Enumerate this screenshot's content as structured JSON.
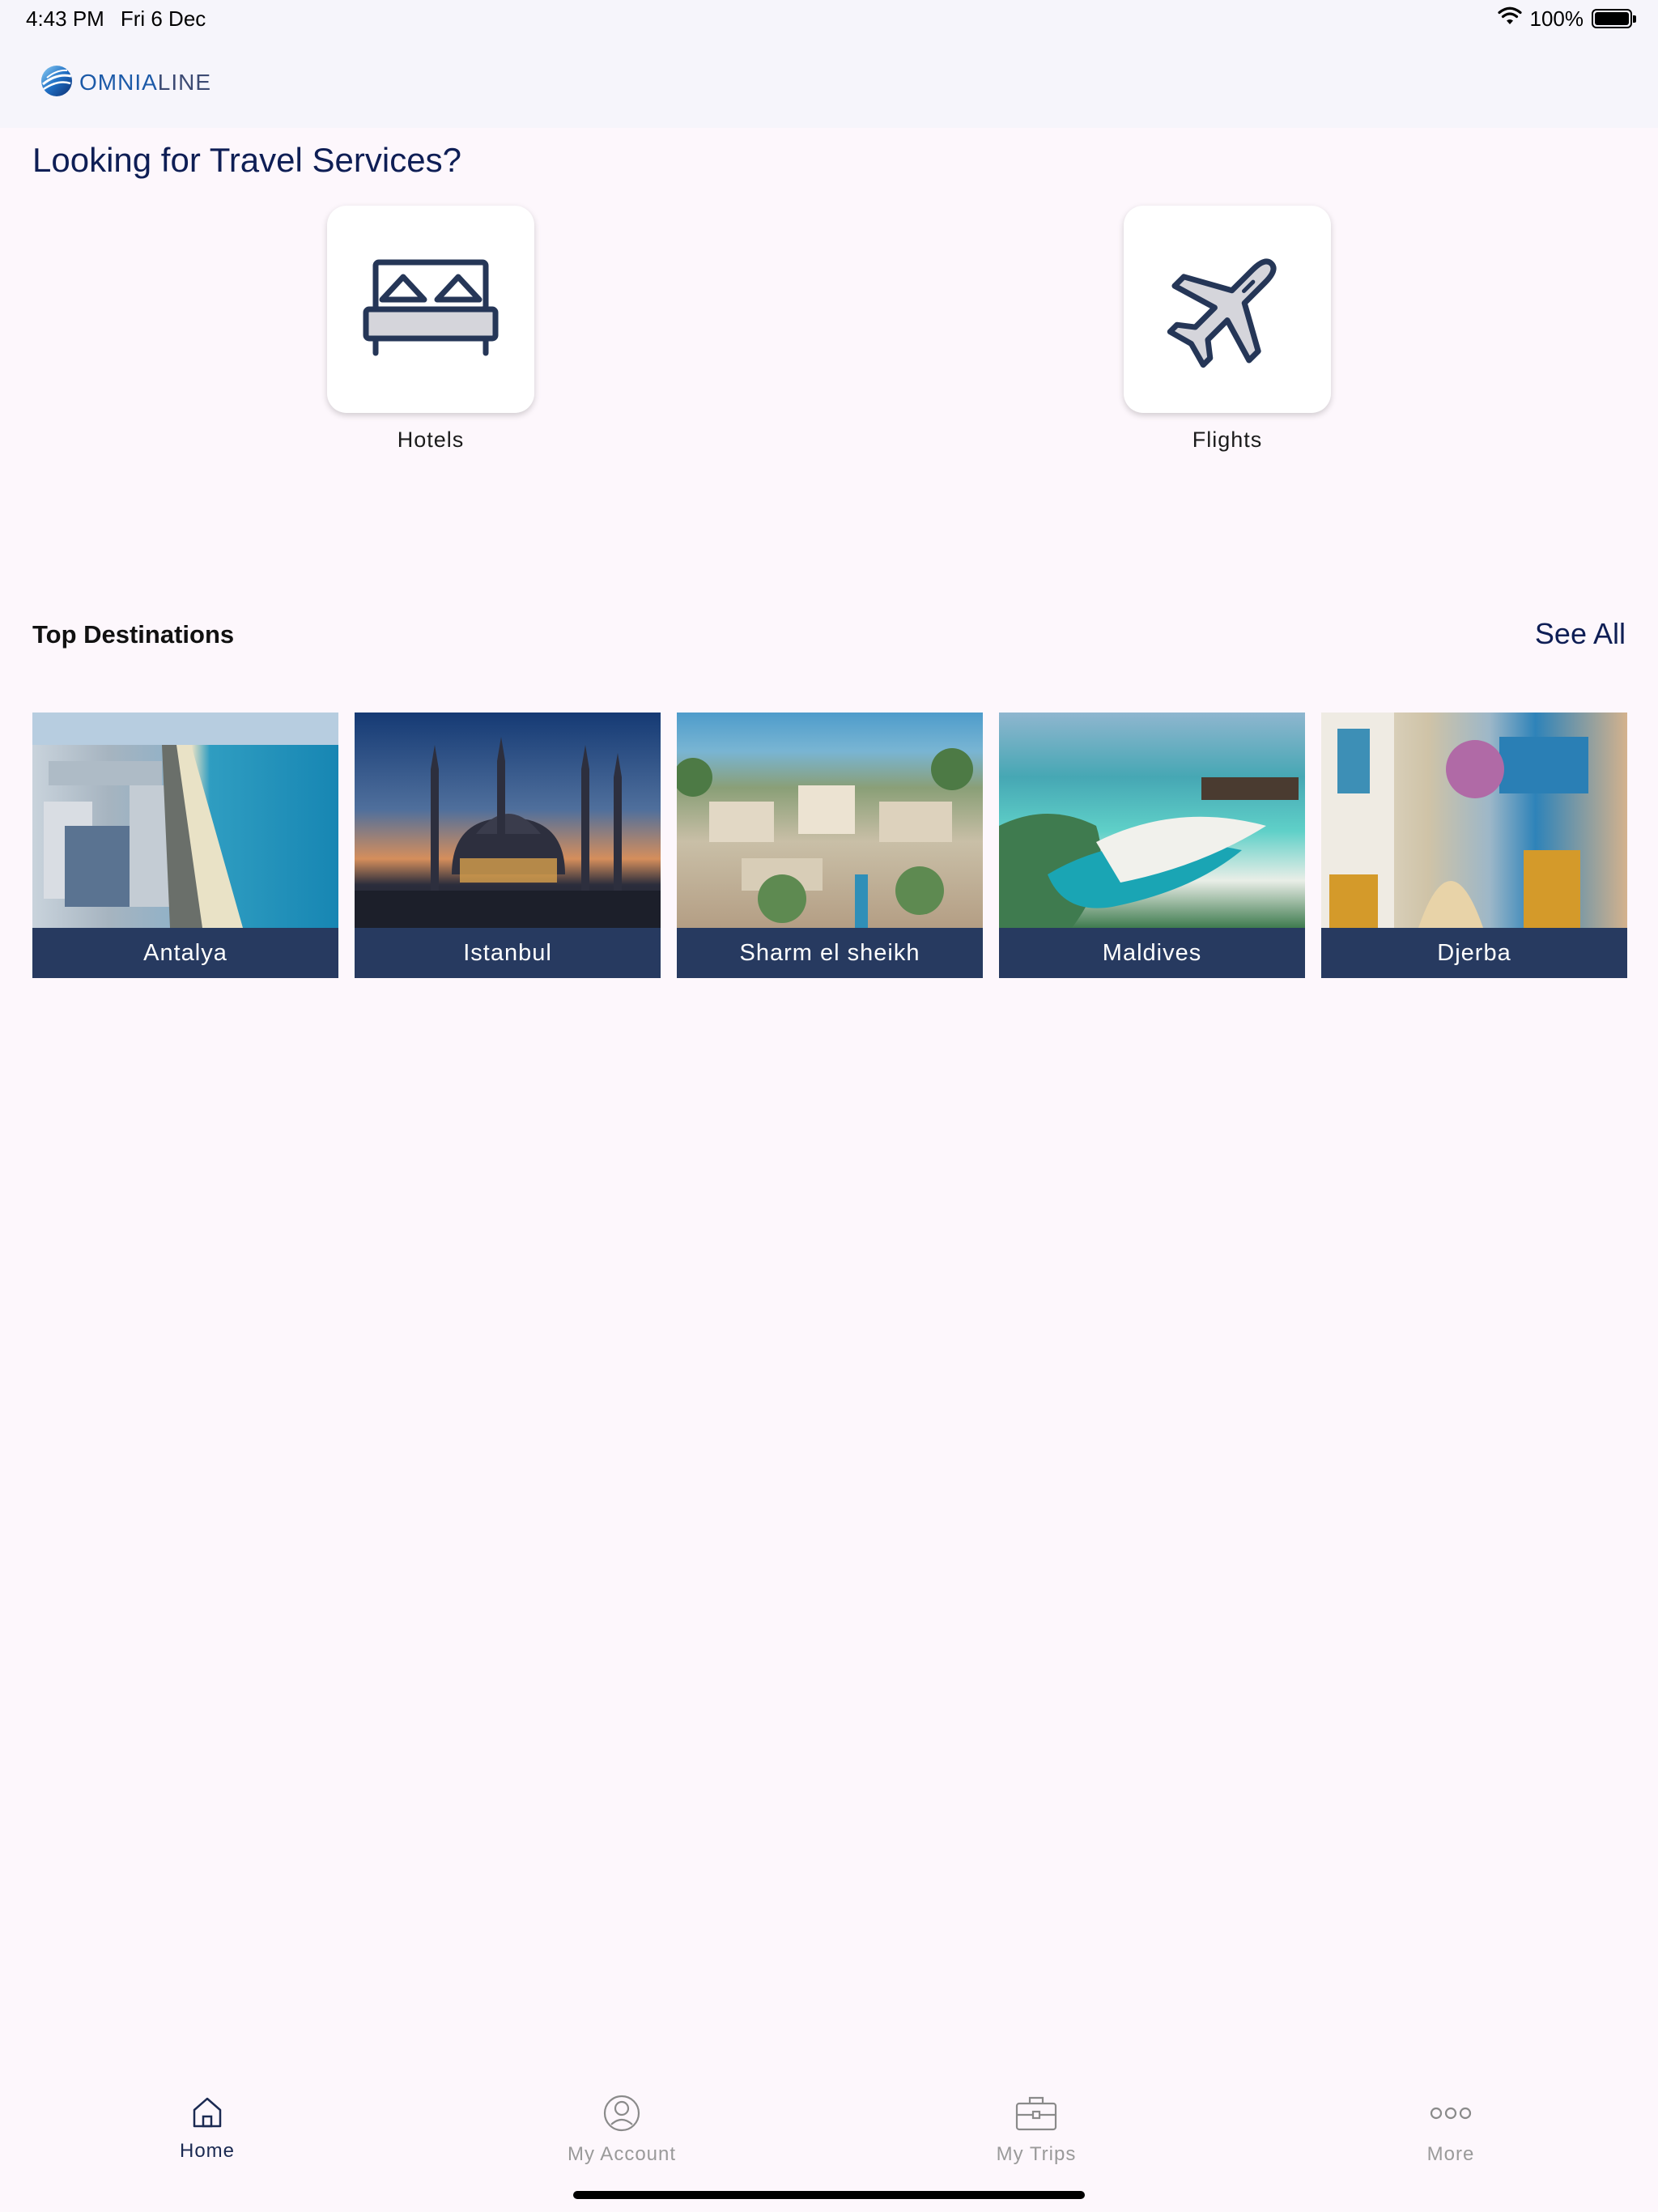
{
  "status_bar": {
    "time": "4:43 PM",
    "date": "Fri 6 Dec",
    "battery": "100%"
  },
  "header": {
    "logo_primary": "OMNIA",
    "logo_secondary": "LINE"
  },
  "services": {
    "title": "Looking for Travel Services?",
    "items": [
      {
        "label": "Hotels",
        "icon": "bed-icon"
      },
      {
        "label": "Flights",
        "icon": "airplane-icon"
      }
    ]
  },
  "destinations": {
    "title": "Top Destinations",
    "see_all": "See All",
    "items": [
      {
        "label": "Antalya"
      },
      {
        "label": "Istanbul"
      },
      {
        "label": "Sharm el sheikh"
      },
      {
        "label": "Maldives"
      },
      {
        "label": "Djerba"
      }
    ]
  },
  "tabs": [
    {
      "label": "Home",
      "icon": "home-icon",
      "active": true
    },
    {
      "label": "My Account",
      "icon": "account-icon",
      "active": false
    },
    {
      "label": "My Trips",
      "icon": "briefcase-icon",
      "active": false
    },
    {
      "label": "More",
      "icon": "more-icon",
      "active": false
    }
  ],
  "colors": {
    "accent": "#0e1e55",
    "card_label_bg": "#273a60",
    "background": "#fdf7fc",
    "tab_active": "#1b2a52",
    "tab_inactive": "#9a9a9a"
  }
}
